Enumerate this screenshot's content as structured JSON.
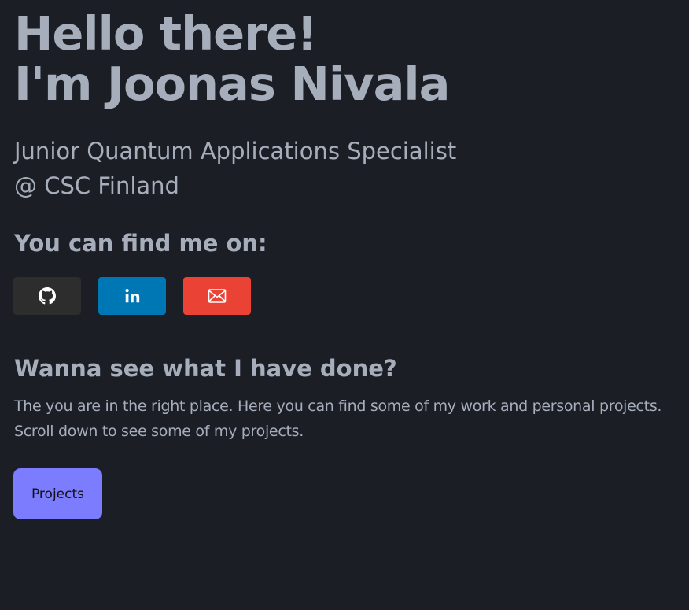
{
  "hero": {
    "line1": "Hello there!",
    "line2": "I'm Joonas Nivala"
  },
  "subtitle": {
    "line1": "Junior Quantum Applications Specialist",
    "line2": "@ CSC Finland"
  },
  "find_me": {
    "heading": "You can find me on:",
    "socials": [
      {
        "name": "github",
        "icon": "github-icon",
        "color": "#2d2d2d"
      },
      {
        "name": "linkedin",
        "icon": "linkedin-icon",
        "color": "#0077b5"
      },
      {
        "name": "email",
        "icon": "mail-icon",
        "color": "#ea4335"
      }
    ]
  },
  "done": {
    "heading": "Wanna see what I have done?",
    "line1": "The you are in the right place. Here you can find some of my work and personal projects.",
    "line2": "Scroll down to see some of my projects."
  },
  "projects_button": {
    "label": "Projects",
    "color": "#7c7cff"
  },
  "colors": {
    "background": "#1b1e25",
    "text": "#a6adbb"
  }
}
